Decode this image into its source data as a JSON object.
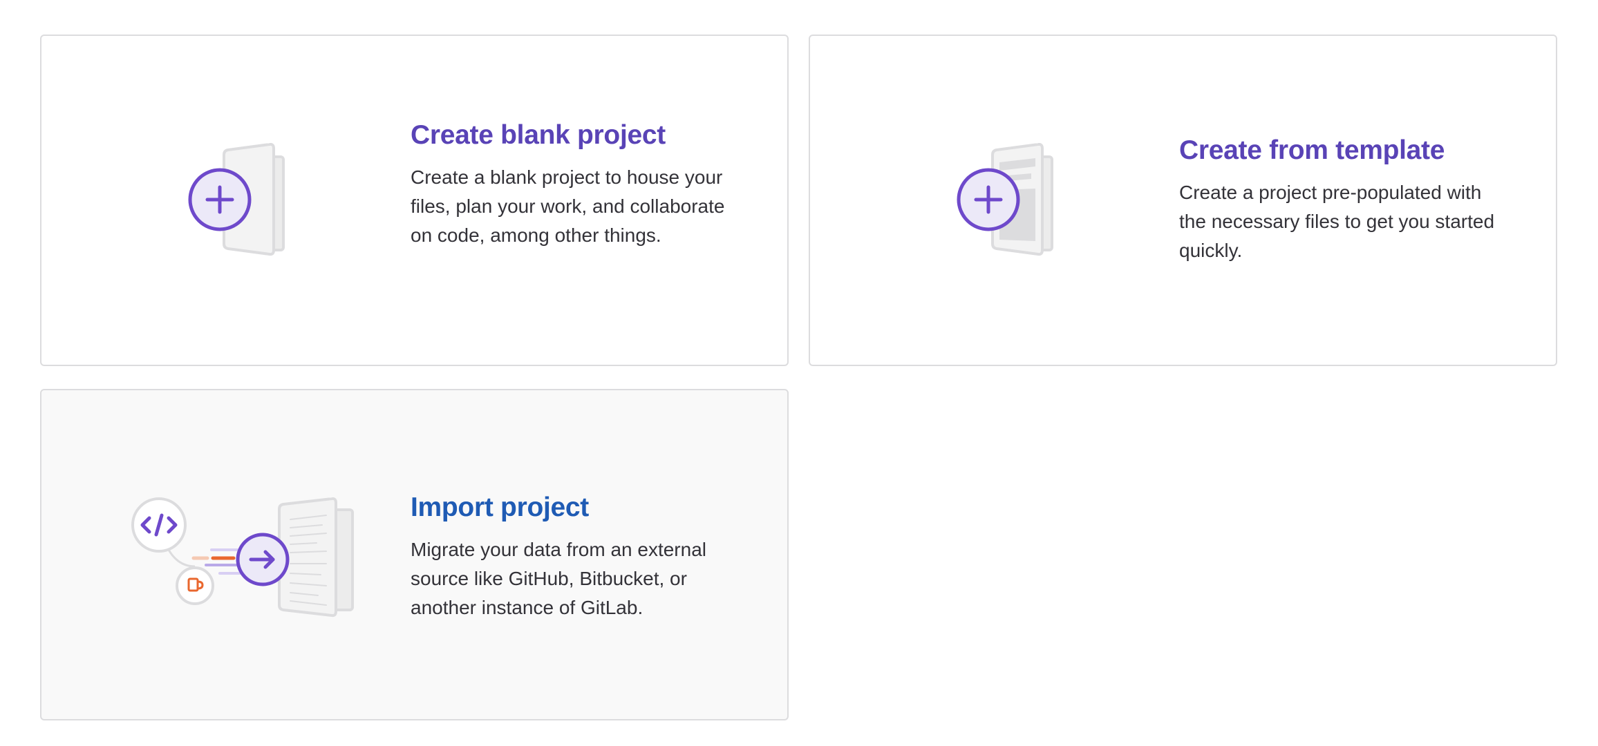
{
  "colors": {
    "title_purple": "#5943b6",
    "title_blue": "#1f5bb4",
    "accent_purple": "#6e49cb",
    "accent_orange": "#e9672e",
    "illustration_gray": "#dcdcde"
  },
  "cards": [
    {
      "id": "blank",
      "icon": "blank-project-illustration",
      "title": "Create blank project",
      "description": "Create a blank project to house your files, plan your work, and collaborate on code, among other things."
    },
    {
      "id": "template",
      "icon": "template-project-illustration",
      "title": "Create from template",
      "description": "Create a project pre-populated with the necessary files to get you started quickly."
    },
    {
      "id": "import",
      "icon": "import-project-illustration",
      "title": "Import project",
      "description": "Migrate your data from an external source like GitHub, Bitbucket, or another instance of GitLab."
    }
  ]
}
